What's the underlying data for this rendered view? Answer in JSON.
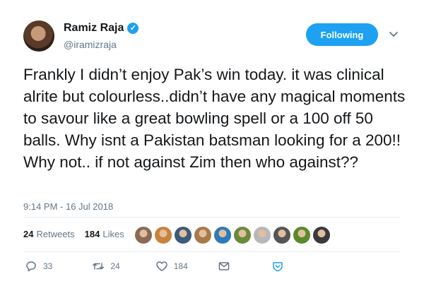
{
  "author": {
    "name": "Ramiz Raja",
    "handle": "@iramizraja",
    "verified": true
  },
  "follow_button": {
    "label": "Following"
  },
  "tweet": {
    "text": "Frankly I didn’t enjoy Pak’s win today. it was clinical alrite but colourless..didn’t have any magical moments to savour like a great bowling spell or a 100 off 50 balls. Why isnt a Pakistan batsman looking for a 200!! Why not.. if not against Zim then who against??",
    "timestamp": "9:14 PM - 16 Jul 2018"
  },
  "stats": {
    "retweets_count": "24",
    "retweets_label": "Retweets",
    "likes_count": "184",
    "likes_label": "Likes"
  },
  "likers": [
    {
      "color": "#8a6a55"
    },
    {
      "color": "#c9823a"
    },
    {
      "color": "#3c5a7a"
    },
    {
      "color": "#a87a4a"
    },
    {
      "color": "#2f7ab8"
    },
    {
      "color": "#6a8a3a"
    },
    {
      "color": "#b8b8b8"
    },
    {
      "color": "#555555"
    },
    {
      "color": "#5a8a2a"
    },
    {
      "color": "#3a3a3a"
    }
  ],
  "actions": {
    "replies": "33",
    "retweets": "24",
    "likes": "184"
  },
  "colors": {
    "accent": "#1da1f2",
    "text": "#14171a",
    "muted": "#657786"
  }
}
